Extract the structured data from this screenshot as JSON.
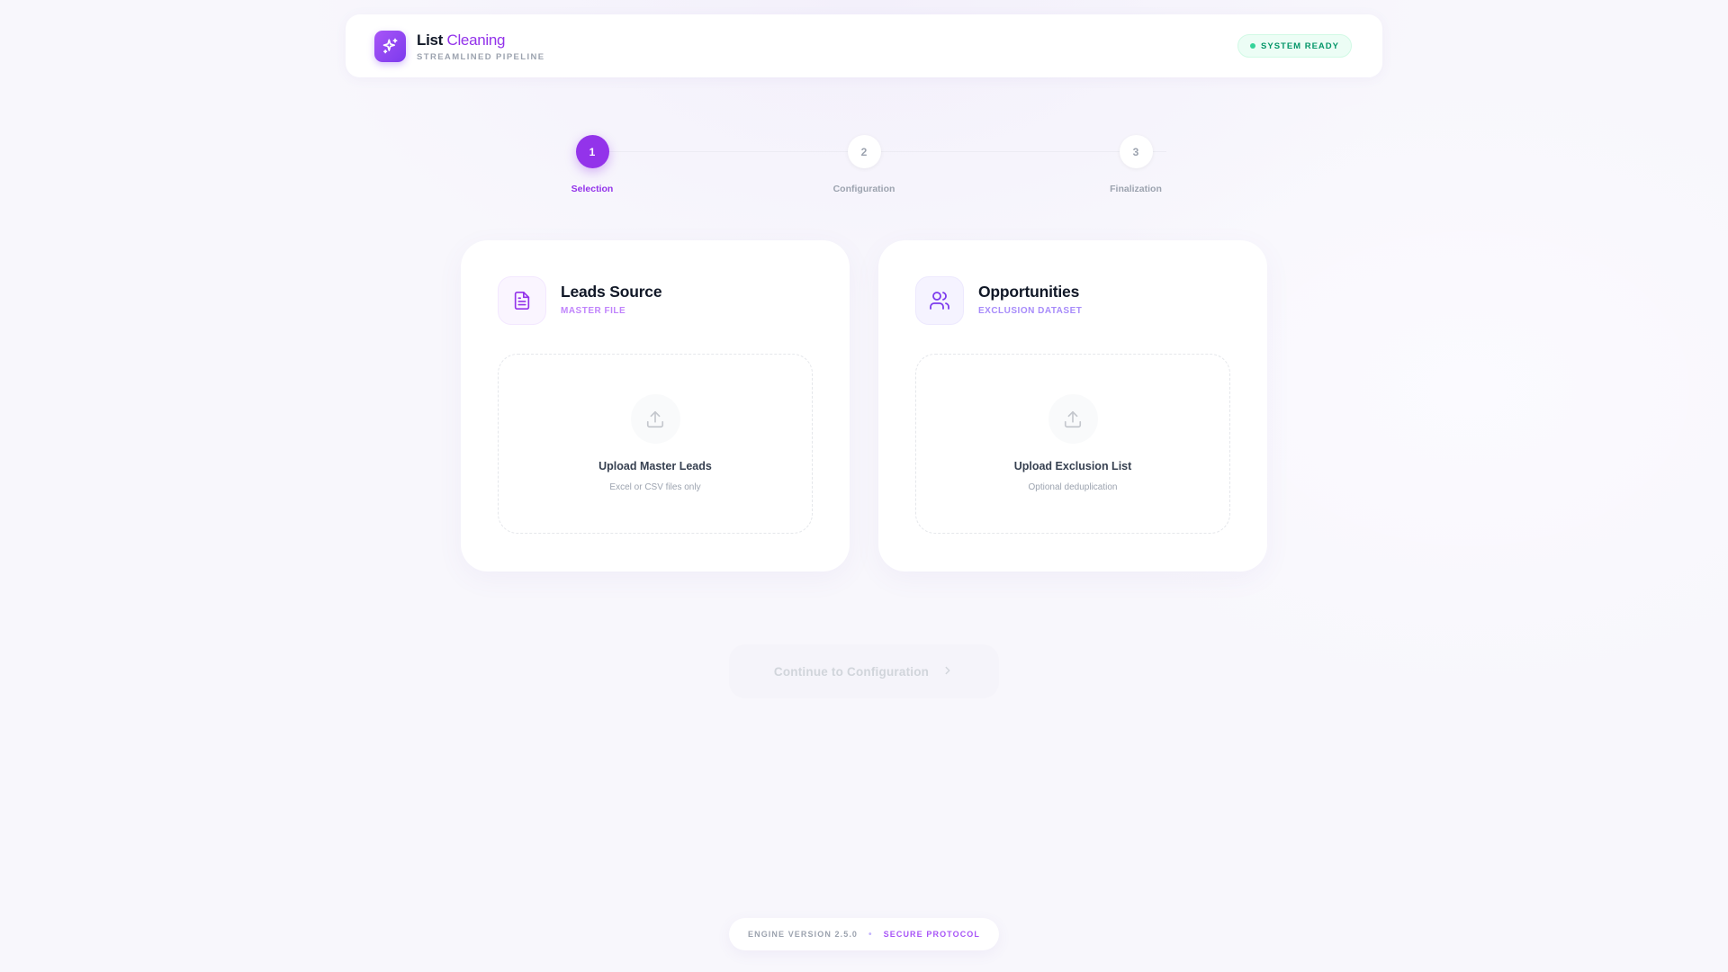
{
  "header": {
    "title_part1": "List",
    "title_part2": "Cleaning",
    "subtitle": "STREAMLINED PIPELINE",
    "logo_icon": "sparkles-icon",
    "status": "SYSTEM READY"
  },
  "stepper": {
    "current_step": 1,
    "steps": [
      {
        "number": "1",
        "label": "Selection"
      },
      {
        "number": "2",
        "label": "Configuration"
      },
      {
        "number": "3",
        "label": "Finalization"
      }
    ]
  },
  "cards": [
    {
      "icon": "document-icon",
      "title": "Leads Source",
      "subtitle": "MASTER FILE",
      "upload_title": "Upload Master Leads",
      "upload_hint": "Excel or CSV files only"
    },
    {
      "icon": "users-icon",
      "title": "Opportunities",
      "subtitle": "EXCLUSION DATASET",
      "upload_title": "Upload Exclusion List",
      "upload_hint": "Optional deduplication"
    }
  ],
  "actions": {
    "continue_label": "Continue to Configuration"
  },
  "footer": {
    "version": "ENGINE VERSION 2.5.0",
    "separator": "•",
    "protocol": "SECURE PROTOCOL"
  },
  "colors": {
    "accent": "#9333ea",
    "accent_light": "#c084fc",
    "status_green": "#059669",
    "background": "#f8f7fc"
  }
}
